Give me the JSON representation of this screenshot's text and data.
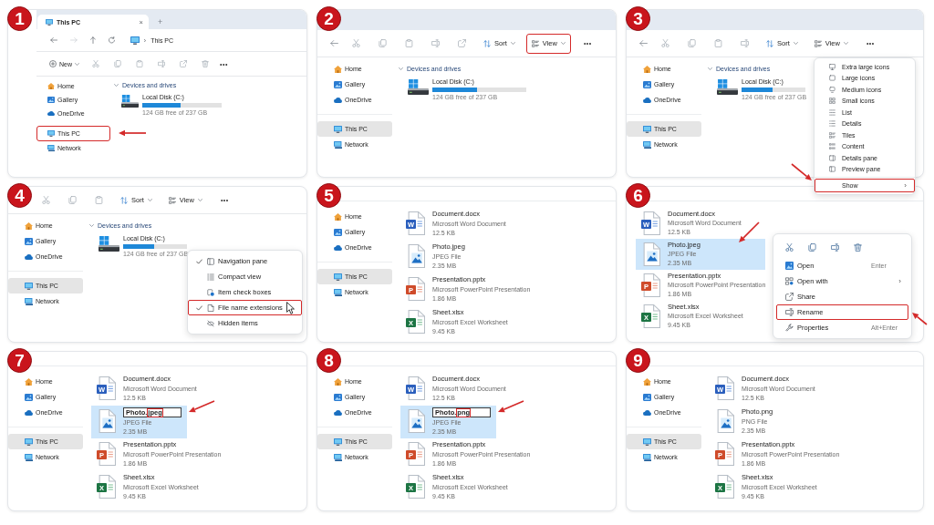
{
  "steps": [
    {
      "step": "1",
      "kind": "full",
      "title_bar": {
        "tabs": [
          {
            "label": "This PC",
            "selected": true,
            "close": "×"
          }
        ],
        "new_tab": "+"
      },
      "address_bar": {
        "separator": "›",
        "path": "This PC"
      },
      "toolbar": [
        {
          "kind": "new",
          "label": "New"
        },
        {
          "kind": "action"
        },
        {
          "kind": "action"
        },
        {
          "kind": "action"
        },
        {
          "kind": "action"
        },
        {
          "kind": "action"
        },
        {
          "kind": "action"
        },
        {
          "kind": "more",
          "label": "•••"
        }
      ],
      "sidebar": [
        {
          "items": [
            {
              "label": "Home",
              "selected": false,
              "highlighted": false,
              "pointer_arrow": false
            },
            {
              "label": "Gallery",
              "selected": false,
              "highlighted": false,
              "pointer_arrow": false
            },
            {
              "label": "OneDrive",
              "selected": false,
              "highlighted": false,
              "pointer_arrow": false
            }
          ]
        },
        {
          "items": [
            {
              "label": "This PC",
              "selected": false,
              "highlighted": true,
              "pointer_arrow": true
            },
            {
              "label": "Network",
              "selected": false,
              "highlighted": false,
              "pointer_arrow": false
            }
          ]
        }
      ],
      "devices": {
        "label": "Devices and drives",
        "expanded": true,
        "drives": [
          {
            "name": "Local Disk (C:)",
            "level": 0.48,
            "free": "124 GB free of 237 GB"
          }
        ]
      }
    },
    {
      "step": "2",
      "kind": "toolbar",
      "toolbar": [
        {
          "kind": "back"
        },
        {
          "kind": "action"
        },
        {
          "kind": "action"
        },
        {
          "kind": "action"
        },
        {
          "kind": "action"
        },
        {
          "kind": "action"
        },
        {
          "kind": "sort",
          "label": "Sort",
          "highlighted": false
        },
        {
          "kind": "view",
          "label": "View",
          "highlighted": true
        },
        {
          "kind": "more",
          "label": "•••"
        }
      ],
      "sidebar": [
        {
          "items": [
            {
              "label": "Home",
              "selected": false
            },
            {
              "label": "Gallery",
              "selected": false
            },
            {
              "label": "OneDrive",
              "selected": false
            }
          ]
        },
        {
          "items": [
            {
              "label": "This PC",
              "selected": true
            },
            {
              "label": "Network",
              "selected": false
            }
          ]
        }
      ],
      "devices": {
        "label": "Devices and drives",
        "expanded": true,
        "drives": [
          {
            "name": "Local Disk (C:)",
            "level": 0.48,
            "free": "124 GB free of 237 GB"
          }
        ]
      }
    },
    {
      "step": "3",
      "kind": "toolbar",
      "toolbar": [
        {
          "kind": "back"
        },
        {
          "kind": "action"
        },
        {
          "kind": "action"
        },
        {
          "kind": "action"
        },
        {
          "kind": "action"
        },
        {
          "kind": "sort",
          "label": "Sort"
        },
        {
          "kind": "view",
          "label": "View"
        },
        {
          "kind": "more",
          "label": "•••"
        }
      ],
      "sidebar": [
        {
          "items": [
            {
              "label": "Home",
              "selected": false
            },
            {
              "label": "Gallery",
              "selected": false
            },
            {
              "label": "OneDrive",
              "selected": false
            }
          ]
        },
        {
          "items": [
            {
              "label": "This PC",
              "selected": true
            },
            {
              "label": "Network",
              "selected": false
            }
          ]
        }
      ],
      "devices": {
        "label": "Devices and drives",
        "expanded": true,
        "drives": [
          {
            "name": "Local Disk (C:)",
            "level": 0.48,
            "free": "124 GB free of 237 GB"
          }
        ]
      },
      "menu": {
        "kind": "view",
        "items": [
          {
            "label": "Extra large icons"
          },
          {
            "label": "Large icons"
          },
          {
            "label": "Medium icons"
          },
          {
            "label": "Small icons"
          },
          {
            "label": "List"
          },
          {
            "label": "Details"
          },
          {
            "label": "Tiles"
          },
          {
            "label": "Content"
          },
          {
            "label": "Details pane"
          },
          {
            "label": "Preview pane"
          }
        ],
        "footer": {
          "label": "Show",
          "submenu": "›",
          "highlighted": true,
          "pointer_arrow": true
        }
      }
    },
    {
      "step": "4",
      "kind": "cropped",
      "toolbar": [
        {
          "kind": "action"
        },
        {
          "kind": "action"
        },
        {
          "kind": "action"
        },
        {
          "kind": "sort",
          "label": "Sort"
        },
        {
          "kind": "view",
          "label": "View"
        },
        {
          "kind": "more",
          "label": "•••"
        }
      ],
      "sidebar": [
        {
          "items": [
            {
              "label": "Home",
              "selected": false
            },
            {
              "label": "Gallery",
              "selected": false
            },
            {
              "label": "OneDrive",
              "selected": false
            }
          ]
        },
        {
          "items": [
            {
              "label": "This PC",
              "selected": true
            },
            {
              "label": "Network",
              "selected": false
            }
          ]
        }
      ],
      "devices": {
        "label": "Devices and drives",
        "expanded": true,
        "drives": [
          {
            "name": "Local Disk (C:)",
            "level": 0.48,
            "free": "124 GB free of 237 GB"
          }
        ]
      },
      "menu": {
        "kind": "show",
        "items": [
          {
            "label": "Navigation pane",
            "checked": true,
            "highlighted": false,
            "hovered": false
          },
          {
            "label": "Compact view",
            "checked": false,
            "highlighted": false,
            "hovered": false
          },
          {
            "label": "Item check boxes",
            "checked": false,
            "highlighted": false,
            "hovered": false
          },
          {
            "label": "File name extensions",
            "checked": true,
            "highlighted": true,
            "hovered": true
          },
          {
            "label": "Hidden items",
            "checked": false,
            "highlighted": false,
            "hovered": false
          }
        ]
      }
    },
    {
      "step": "5",
      "kind": "files",
      "sidebar": [
        {
          "items": [
            {
              "label": "Home",
              "selected": false
            },
            {
              "label": "Gallery",
              "selected": false
            },
            {
              "label": "OneDrive",
              "selected": false
            }
          ]
        },
        {
          "items": [
            {
              "label": "This PC",
              "selected": true
            },
            {
              "label": "Network",
              "selected": false
            }
          ]
        }
      ],
      "files": [
        {
          "name": "Document.docx",
          "type": "Microsoft Word Document",
          "size": "12.5 KB",
          "kind": "word",
          "letter": "W",
          "selected": false
        },
        {
          "name": "Photo.jpeg",
          "type": "JPEG File",
          "size": "2.35 MB",
          "kind": "image",
          "selected": false
        },
        {
          "name": "Presentation.pptx",
          "type": "Microsoft PowerPoint Presentation",
          "size": "1.86 MB",
          "kind": "slides",
          "letter": "P",
          "selected": false
        },
        {
          "name": "Sheet.xlsx",
          "type": "Microsoft Excel Worksheet",
          "size": "9.45 KB",
          "kind": "sheet",
          "letter": "X",
          "selected": false
        }
      ]
    },
    {
      "step": "6",
      "kind": "files",
      "files": [
        {
          "name": "Document.docx",
          "type": "Microsoft Word Document",
          "size": "12.5 KB",
          "kind": "word",
          "letter": "W",
          "selected": false,
          "pointer_arrow": false
        },
        {
          "name": "Photo.jpeg",
          "type": "JPEG File",
          "size": "2.35 MB",
          "kind": "image",
          "selected": true,
          "pointer_arrow": true
        },
        {
          "name": "Presentation.pptx",
          "type": "Microsoft PowerPoint Presentation",
          "size": "1.86 MB",
          "kind": "slides",
          "letter": "P",
          "selected": false,
          "pointer_arrow": false
        },
        {
          "name": "Sheet.xlsx",
          "type": "Microsoft Excel Worksheet",
          "size": "9.45 KB",
          "kind": "sheet",
          "letter": "X",
          "selected": false,
          "pointer_arrow": false
        }
      ],
      "menu": {
        "kind": "context",
        "items": [
          {
            "label": "Open",
            "shortcut": "Enter",
            "highlighted": false,
            "pointer_arrow": false
          },
          {
            "label": "Open with",
            "submenu": "›",
            "highlighted": false,
            "pointer_arrow": false
          },
          {
            "label": "Share",
            "highlighted": false,
            "pointer_arrow": false
          },
          {
            "label": "Rename",
            "highlighted": true,
            "pointer_arrow": true
          },
          {
            "label": "Properties",
            "shortcut": "Alt+Enter",
            "highlighted": false,
            "pointer_arrow": false
          }
        ]
      }
    },
    {
      "step": "7",
      "kind": "files",
      "sidebar": [
        {
          "items": [
            {
              "label": "Home",
              "selected": false
            },
            {
              "label": "Gallery",
              "selected": false
            },
            {
              "label": "OneDrive",
              "selected": false
            }
          ]
        },
        {
          "items": [
            {
              "label": "This PC",
              "selected": true
            },
            {
              "label": "Network",
              "selected": false
            }
          ]
        }
      ],
      "files": [
        {
          "name": "Document.docx",
          "type": "Microsoft Word Document",
          "size": "12.5 KB",
          "kind": "word",
          "letter": "W",
          "selected": false,
          "renaming": false,
          "pointer_arrow": false
        },
        {
          "name": "Photo.",
          "extension": "jpeg",
          "type": "JPEG File",
          "size": "2.35 MB",
          "kind": "image",
          "selected": true,
          "renaming": true,
          "pointer_arrow": true
        },
        {
          "name": "Presentation.pptx",
          "type": "Microsoft PowerPoint Presentation",
          "size": "1.86 MB",
          "kind": "slides",
          "letter": "P",
          "selected": false,
          "renaming": false,
          "pointer_arrow": false
        },
        {
          "name": "Sheet.xlsx",
          "type": "Microsoft Excel Worksheet",
          "size": "9.45 KB",
          "kind": "sheet",
          "letter": "X",
          "selected": false,
          "renaming": false,
          "pointer_arrow": false
        }
      ]
    },
    {
      "step": "8",
      "kind": "files",
      "sidebar": [
        {
          "items": [
            {
              "label": "Home",
              "selected": false
            },
            {
              "label": "Gallery",
              "selected": false
            },
            {
              "label": "OneDrive",
              "selected": false
            }
          ]
        },
        {
          "items": [
            {
              "label": "This PC",
              "selected": true
            },
            {
              "label": "Network",
              "selected": false
            }
          ]
        }
      ],
      "files": [
        {
          "name": "Document.docx",
          "type": "Microsoft Word Document",
          "size": "12.5 KB",
          "kind": "word",
          "letter": "W",
          "selected": false,
          "renaming": false,
          "pointer_arrow": false
        },
        {
          "name": "Photo.",
          "extension": "png",
          "type": "JPEG File",
          "size": "2.35 MB",
          "kind": "image",
          "selected": true,
          "renaming": true,
          "pointer_arrow": true
        },
        {
          "name": "Presentation.pptx",
          "type": "Microsoft PowerPoint Presentation",
          "size": "1.86 MB",
          "kind": "slides",
          "letter": "P",
          "selected": false,
          "renaming": false,
          "pointer_arrow": false
        },
        {
          "name": "Sheet.xlsx",
          "type": "Microsoft Excel Worksheet",
          "size": "9.45 KB",
          "kind": "sheet",
          "letter": "X",
          "selected": false,
          "renaming": false,
          "pointer_arrow": false
        }
      ]
    },
    {
      "step": "9",
      "kind": "files",
      "sidebar": [
        {
          "items": [
            {
              "label": "Home",
              "selected": false
            },
            {
              "label": "Gallery",
              "selected": false
            },
            {
              "label": "OneDrive",
              "selected": false
            }
          ]
        },
        {
          "items": [
            {
              "label": "This PC",
              "selected": true
            },
            {
              "label": "Network",
              "selected": false
            }
          ]
        }
      ],
      "files": [
        {
          "name": "Document.docx",
          "type": "Microsoft Word Document",
          "size": "12.5 KB",
          "kind": "word",
          "letter": "W",
          "selected": false
        },
        {
          "name": "Photo.png",
          "type": "PNG File",
          "size": "2.35 MB",
          "kind": "image",
          "selected": false
        },
        {
          "name": "Presentation.pptx",
          "type": "Microsoft PowerPoint Presentation",
          "size": "1.86 MB",
          "kind": "slides",
          "letter": "P",
          "selected": false
        },
        {
          "name": "Sheet.xlsx",
          "type": "Microsoft Excel Worksheet",
          "size": "9.45 KB",
          "kind": "sheet",
          "letter": "X",
          "selected": false
        }
      ]
    }
  ]
}
